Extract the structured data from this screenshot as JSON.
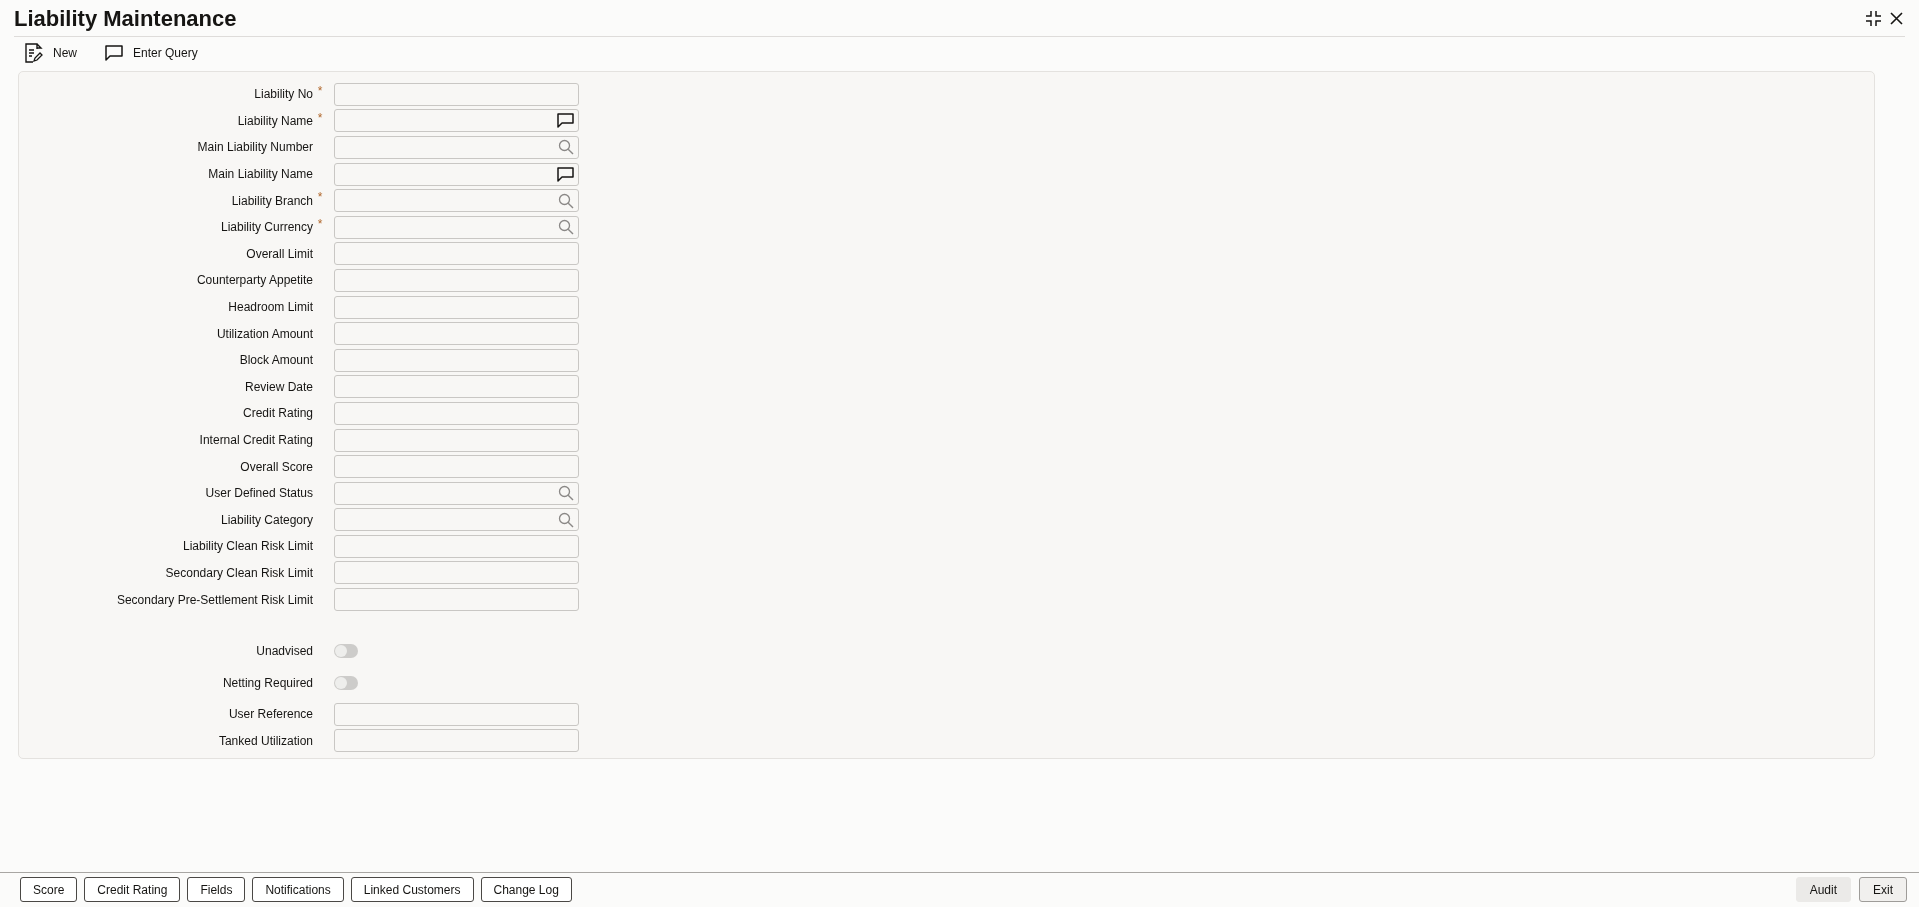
{
  "window": {
    "title": "Liability Maintenance"
  },
  "toolbar": [
    {
      "label": "New",
      "kind": "new"
    },
    {
      "label": "Enter Query",
      "kind": "query"
    }
  ],
  "fields": [
    {
      "label": "Liability No",
      "kind": "text",
      "required_mark": "*"
    },
    {
      "label": "Liability Name",
      "kind": "popup",
      "required_mark": "*"
    },
    {
      "label": "Main Liability Number",
      "kind": "lov"
    },
    {
      "label": "Main Liability Name",
      "kind": "popup"
    },
    {
      "label": "Liability Branch",
      "kind": "lov",
      "required_mark": "*"
    },
    {
      "label": "Liability Currency",
      "kind": "lov",
      "required_mark": "*"
    },
    {
      "label": "Overall Limit",
      "kind": "text"
    },
    {
      "label": "Counterparty Appetite",
      "kind": "text"
    },
    {
      "label": "Headroom Limit",
      "kind": "text"
    },
    {
      "label": "Utilization Amount",
      "kind": "text"
    },
    {
      "label": "Block Amount",
      "kind": "text"
    },
    {
      "label": "Review Date",
      "kind": "text"
    },
    {
      "label": "Credit Rating",
      "kind": "text"
    },
    {
      "label": "Internal Credit Rating",
      "kind": "text"
    },
    {
      "label": "Overall Score",
      "kind": "text"
    },
    {
      "label": "User Defined Status",
      "kind": "lov"
    },
    {
      "label": "Liability Category",
      "kind": "lov"
    },
    {
      "label": "Liability Clean Risk Limit",
      "kind": "text"
    },
    {
      "label": "Secondary Clean Risk Limit",
      "kind": "text"
    },
    {
      "label": "Secondary Pre-Settlement Risk Limit",
      "kind": "text"
    },
    {
      "label": "Unadvised",
      "kind": "toggle",
      "on": false
    },
    {
      "label": "Netting Required",
      "kind": "toggle",
      "on": false
    },
    {
      "label": "User Reference",
      "kind": "text"
    },
    {
      "label": "Tanked Utilization",
      "kind": "text"
    }
  ],
  "footer_buttons": [
    {
      "label": "Score"
    },
    {
      "label": "Credit Rating"
    },
    {
      "label": "Fields"
    },
    {
      "label": "Notifications"
    },
    {
      "label": "Linked Customers"
    },
    {
      "label": "Change Log"
    }
  ],
  "footer_actions": [
    {
      "label": "Audit",
      "disabled": true
    },
    {
      "label": "Exit",
      "disabled": false
    }
  ]
}
